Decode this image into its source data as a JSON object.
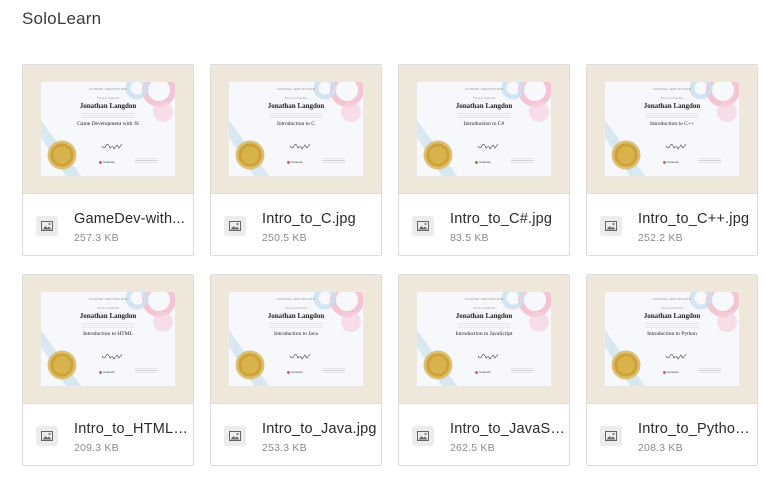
{
  "page": {
    "title": "SoloLearn"
  },
  "certificate": {
    "header": "COURSE CERTIFICATE",
    "awarded_to": "This is to certify that",
    "recipient": "Jonathan Langdon",
    "brand": "sololearn"
  },
  "files": [
    {
      "name": "GameDev-with...",
      "size": "257.3 KB",
      "course": "Game Development with JS",
      "icon": "image-file-icon"
    },
    {
      "name": "Intro_to_C.jpg",
      "size": "250.5 KB",
      "course": "Introduction to C",
      "icon": "image-file-icon"
    },
    {
      "name": "Intro_to_C#.jpg",
      "size": "83.5 KB",
      "course": "Introduction to C#",
      "icon": "image-file-icon"
    },
    {
      "name": "Intro_to_C++.jpg",
      "size": "252.2 KB",
      "course": "Introduction to C++",
      "icon": "image-file-icon"
    },
    {
      "name": "Intro_to_HTML....",
      "size": "209.3 KB",
      "course": "Introduction to HTML",
      "icon": "image-file-icon"
    },
    {
      "name": "Intro_to_Java.jpg",
      "size": "253.3 KB",
      "course": "Introduction to Java",
      "icon": "image-file-icon"
    },
    {
      "name": "Intro_to_JavaSc...",
      "size": "262.5 KB",
      "course": "Introduction to JavaScript",
      "icon": "image-file-icon"
    },
    {
      "name": "Intro_to_Python...",
      "size": "208.3 KB",
      "course": "Introduction to Python",
      "icon": "image-file-icon"
    }
  ]
}
